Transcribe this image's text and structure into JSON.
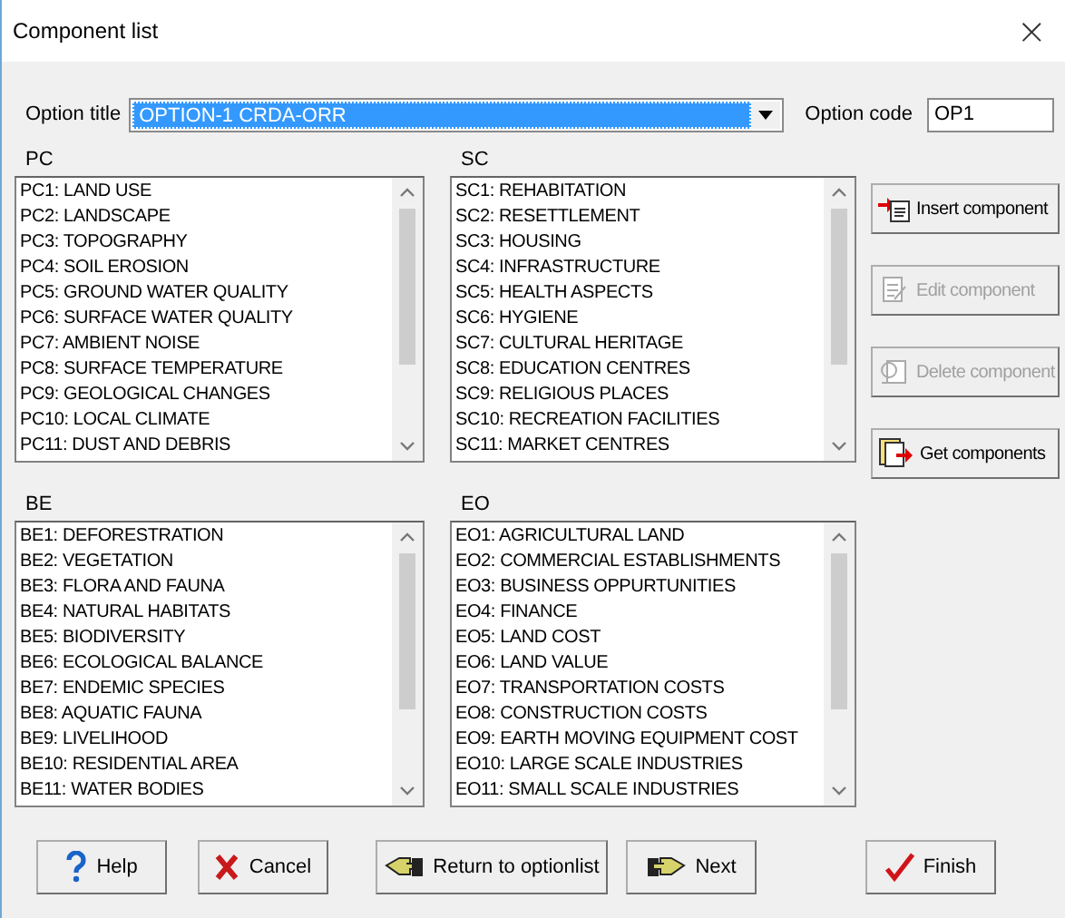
{
  "window": {
    "title": "Component list",
    "close": "×"
  },
  "option_title": {
    "label": "Option title",
    "value": "OPTION-1 CRDA-ORR"
  },
  "option_code": {
    "label": "Option code",
    "value": "OP1"
  },
  "lists": [
    {
      "label": "PC",
      "items": [
        "PC1: LAND USE",
        "PC2: LANDSCAPE",
        "PC3: TOPOGRAPHY",
        "PC4: SOIL EROSION",
        "PC5: GROUND WATER QUALITY",
        "PC6: SURFACE WATER QUALITY",
        "PC7: AMBIENT NOISE",
        "PC8: SURFACE TEMPERATURE",
        "PC9: GEOLOGICAL CHANGES",
        "PC10: LOCAL CLIMATE",
        "PC11: DUST AND DEBRIS"
      ]
    },
    {
      "label": "SC",
      "items": [
        "SC1: REHABITATION",
        "SC2: RESETTLEMENT",
        "SC3: HOUSING",
        "SC4: INFRASTRUCTURE",
        "SC5: HEALTH ASPECTS",
        "SC6: HYGIENE",
        "SC7: CULTURAL HERITAGE",
        "SC8: EDUCATION CENTRES",
        "SC9: RELIGIOUS PLACES",
        "SC10: RECREATION FACILITIES",
        "SC11: MARKET CENTRES"
      ]
    },
    {
      "label": "BE",
      "items": [
        "BE1: DEFORESTRATION",
        "BE2: VEGETATION",
        "BE3: FLORA AND FAUNA",
        "BE4: NATURAL HABITATS",
        "BE5: BIODIVERSITY",
        "BE6: ECOLOGICAL BALANCE",
        "BE7: ENDEMIC SPECIES",
        "BE8: AQUATIC FAUNA",
        "BE9: LIVELIHOOD",
        "BE10: RESIDENTIAL AREA",
        "BE11: WATER BODIES"
      ]
    },
    {
      "label": "EO",
      "items": [
        "EO1: AGRICULTURAL LAND",
        "EO2: COMMERCIAL ESTABLISHMENTS",
        "EO3: BUSINESS OPPURTUNITIES",
        "EO4: FINANCE",
        "EO5: LAND COST",
        "EO6: LAND VALUE",
        "EO7: TRANSPORTATION COSTS",
        "EO8: CONSTRUCTION COSTS",
        "EO9: EARTH MOVING EQUIPMENT COST",
        "EO10: LARGE SCALE INDUSTRIES",
        "EO11: SMALL SCALE INDUSTRIES"
      ]
    }
  ],
  "side_buttons": [
    {
      "label": "Insert component",
      "kind": "insert",
      "disabled": false
    },
    {
      "label": "Edit component",
      "kind": "edit",
      "disabled": true
    },
    {
      "label": "Delete component",
      "kind": "delete",
      "disabled": true
    },
    {
      "label": "Get components",
      "kind": "get",
      "disabled": false
    }
  ],
  "bottom_buttons": [
    {
      "label": "Help",
      "kind": "help"
    },
    {
      "label": "Cancel",
      "kind": "cancel"
    },
    {
      "label": "Return to optionlist",
      "kind": "return"
    },
    {
      "label": "Next",
      "kind": "next"
    },
    {
      "label": "Finish",
      "kind": "finish"
    }
  ]
}
